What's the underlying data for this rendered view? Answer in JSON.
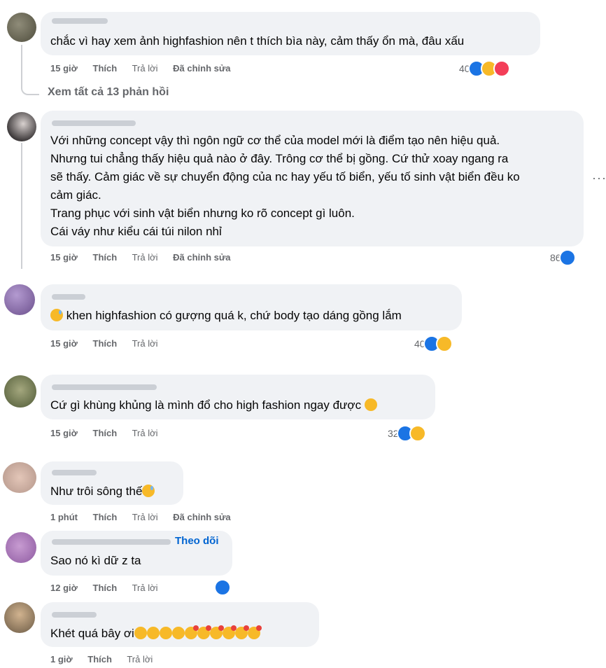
{
  "ui": {
    "more_label": "···",
    "follow_label": "Theo dõi"
  },
  "comments": [
    {
      "text": "chắc vì hay xem ảnh highfashion nên t thích bìa này, cảm thấy ổn mà, đâu xấu",
      "time": "15 giờ",
      "like_label": "Thích",
      "reply_label": "Trả lời",
      "edited_label": "Đã chỉnh sửa",
      "reaction_count": "40",
      "reactions": [
        "like-icon",
        "haha-icon",
        "love-icon"
      ]
    },
    {
      "view_replies": "Xem tất cả 13 phản hồi"
    },
    {
      "lines": [
        "Với những concept vậy thì ngôn ngữ cơ thể của model mới là điểm tạo nên hiệu quả.",
        "Nhưng tui chẳng thấy hiệu quả nào ở đây. Trông cơ thể bị gồng. Cứ thử xoay ngang ra",
        "sẽ thấy. Cảm giác về sự chuyển động của nc hay yếu tố biển, yếu tố sinh vật biển đều ko",
        "cảm giác.",
        "Trang phục với sinh vật biển nhưng ko rõ concept gì luôn.",
        "Cái váy như kiểu cái túi nilon nhỉ"
      ],
      "time": "15 giờ",
      "like_label": "Thích",
      "reply_label": "Trả lời",
      "edited_label": "Đã chỉnh sửa",
      "reaction_count": "86",
      "reactions": [
        "like-icon"
      ]
    },
    {
      "text": "khen highfashion có gượng quá k, chứ body tạo dáng gồng lắm",
      "time": "15 giờ",
      "like_label": "Thích",
      "reply_label": "Trả lời",
      "reaction_count": "40",
      "reactions": [
        "like-icon",
        "haha-icon"
      ]
    },
    {
      "text": "Cứ gì khùng khủng là mình đổ cho high fashion ngay được",
      "time": "15 giờ",
      "like_label": "Thích",
      "reply_label": "Trả lời",
      "reaction_count": "32",
      "reactions": [
        "like-icon",
        "haha-icon"
      ]
    },
    {
      "text": "Như trôi sông thế",
      "time": "1 phút",
      "like_label": "Thích",
      "reply_label": "Trả lời",
      "edited_label": "Đã chỉnh sửa"
    },
    {
      "text": "Sao nó kì dữ z ta",
      "time": "12 giờ",
      "like_label": "Thích",
      "reply_label": "Trả lời",
      "reactions": [
        "like-icon"
      ]
    },
    {
      "text": "Khét quá bây ơi",
      "time": "1 giờ",
      "like_label": "Thích",
      "reply_label": "Trả lời"
    }
  ],
  "colors": {
    "bubble": "#f0f2f5",
    "muted": "#65676b",
    "like": "#1b74e4",
    "link": "#0064d1"
  }
}
